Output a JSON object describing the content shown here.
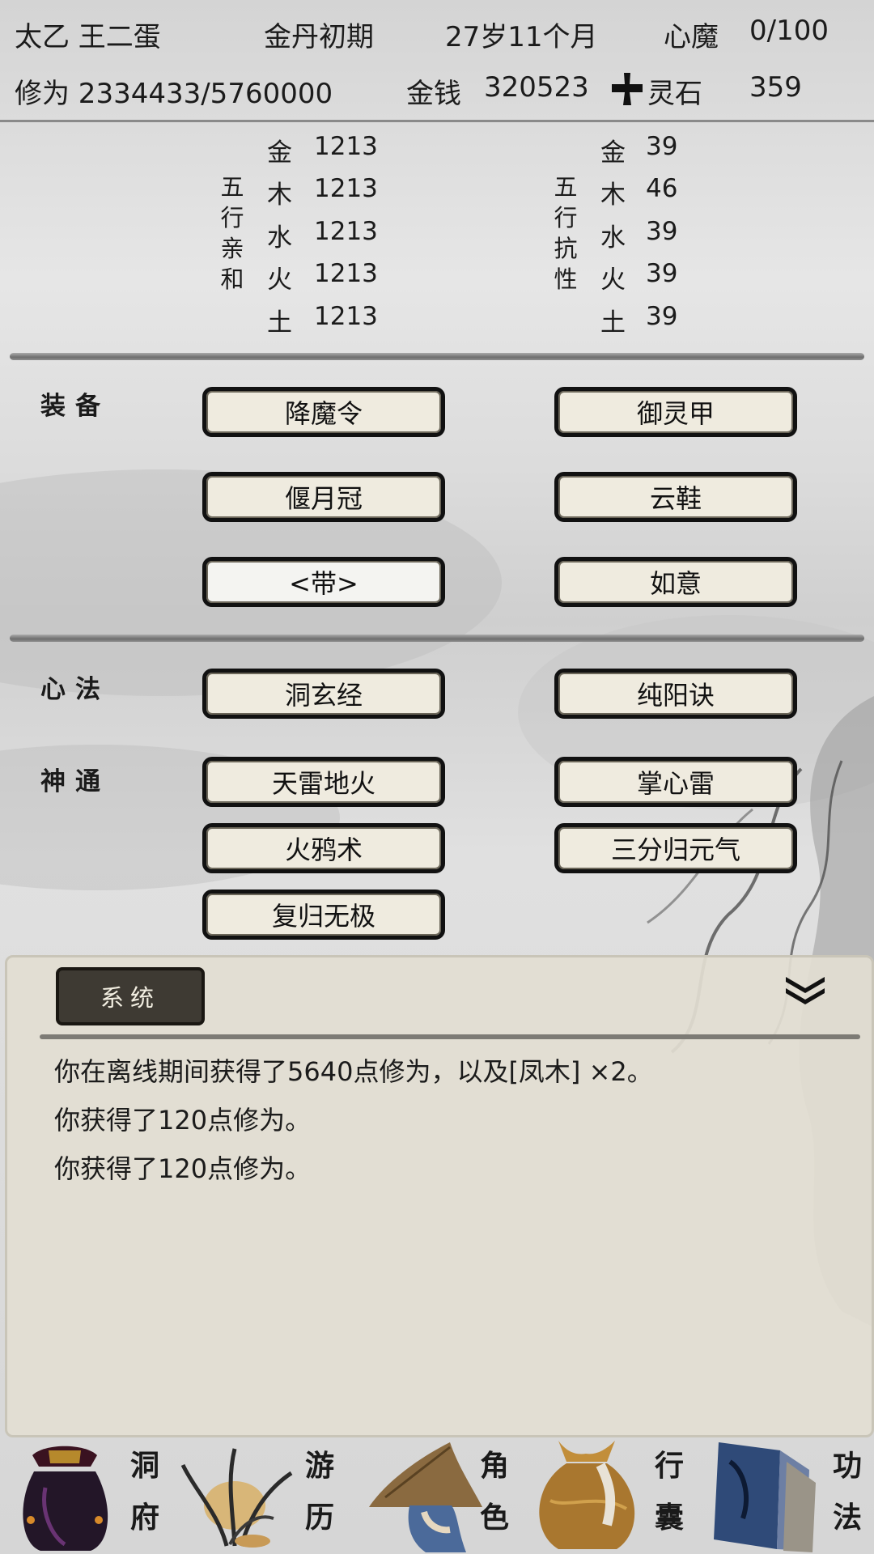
{
  "header": {
    "name": "太乙 王二蛋",
    "realm": "金丹初期",
    "age": "27岁11个月",
    "demon_label": "心魔",
    "demon_value": "0/100",
    "cultivation": "修为 2334433/5760000",
    "money_label": "金钱",
    "money_value": "320523",
    "stone_label": "灵石",
    "stone_value": "359"
  },
  "affinity": {
    "title": "五行亲和",
    "rows": [
      {
        "el": "金",
        "val": "1213"
      },
      {
        "el": "木",
        "val": "1213"
      },
      {
        "el": "水",
        "val": "1213"
      },
      {
        "el": "火",
        "val": "1213"
      },
      {
        "el": "土",
        "val": "1213"
      }
    ]
  },
  "resistance": {
    "title": "五行抗性",
    "rows": [
      {
        "el": "金",
        "val": "39"
      },
      {
        "el": "木",
        "val": "46"
      },
      {
        "el": "水",
        "val": "39"
      },
      {
        "el": "火",
        "val": "39"
      },
      {
        "el": "土",
        "val": "39"
      }
    ]
  },
  "equipment": {
    "label": "装备",
    "items": [
      "降魔令",
      "御灵甲",
      "偃月冠",
      "云鞋",
      "<带>",
      "如意"
    ]
  },
  "mind": {
    "label": "心法",
    "items": [
      "洞玄经",
      "纯阳诀"
    ]
  },
  "skills": {
    "label": "神通",
    "items": [
      "天雷地火",
      "掌心雷",
      "火鸦术",
      "三分归元气",
      "复归无极"
    ]
  },
  "log": {
    "tab": "系统",
    "collapse_icon": "double-chevron-down-icon",
    "lines": [
      "你在离线期间获得了5640点修为，以及[凤木] ×2。",
      "你获得了120点修为。",
      "你获得了120点修为。"
    ]
  },
  "nav": {
    "items": [
      {
        "top": "洞",
        "bottom": "府",
        "icon": "treasure-bag-icon"
      },
      {
        "top": "游",
        "bottom": "历",
        "icon": "herb-icon"
      },
      {
        "top": "角",
        "bottom": "色",
        "icon": "straw-hat-icon"
      },
      {
        "top": "行",
        "bottom": "囊",
        "icon": "sack-icon"
      },
      {
        "top": "功",
        "bottom": "法",
        "icon": "books-icon"
      }
    ]
  }
}
